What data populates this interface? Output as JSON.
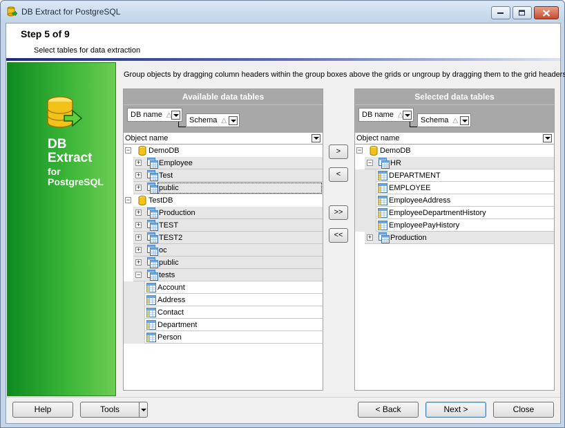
{
  "window": {
    "title": "DB Extract for PostgreSQL"
  },
  "header": {
    "step": "Step 5 of 9",
    "subtitle": "Select tables for data extraction"
  },
  "banner": {
    "line1": "DB",
    "line2": "Extract",
    "line3": "for",
    "line4": "PostgreSQL"
  },
  "hint": "Group objects by dragging column headers within the group boxes above the grids or ungroup by dragging them to the grid headers",
  "left_panel": {
    "title": "Available data tables",
    "group_headers": [
      "DB name",
      "Schema"
    ],
    "column": "Object name",
    "rows": [
      {
        "label": "DemoDB",
        "type": "db",
        "expanded": true
      },
      {
        "label": "Employee",
        "type": "schema"
      },
      {
        "label": "Test",
        "type": "schema"
      },
      {
        "label": "public",
        "type": "schema",
        "selected": true
      },
      {
        "label": "TestDB",
        "type": "db",
        "expanded": true
      },
      {
        "label": "Production",
        "type": "schema"
      },
      {
        "label": "TEST",
        "type": "schema"
      },
      {
        "label": "TEST2",
        "type": "schema"
      },
      {
        "label": "oc",
        "type": "schema"
      },
      {
        "label": "public",
        "type": "schema"
      },
      {
        "label": "tests",
        "type": "schema",
        "expanded": true
      },
      {
        "label": "Account",
        "type": "table"
      },
      {
        "label": "Address",
        "type": "table"
      },
      {
        "label": "Contact",
        "type": "table"
      },
      {
        "label": "Department",
        "type": "table"
      },
      {
        "label": "Person",
        "type": "table"
      }
    ]
  },
  "right_panel": {
    "title": "Selected data tables",
    "group_headers": [
      "DB name",
      "Schema"
    ],
    "column": "Object name",
    "rows": [
      {
        "label": "DemoDB",
        "type": "db",
        "expanded": true
      },
      {
        "label": "HR",
        "type": "schema",
        "expanded": true
      },
      {
        "label": "DEPARTMENT",
        "type": "table"
      },
      {
        "label": "EMPLOYEE",
        "type": "table"
      },
      {
        "label": "EmployeeAddress",
        "type": "table"
      },
      {
        "label": "EmployeeDepartmentHistory",
        "type": "table"
      },
      {
        "label": "EmployeePayHistory",
        "type": "table"
      },
      {
        "label": "Production",
        "type": "schema"
      }
    ]
  },
  "transfer": {
    "add": ">",
    "remove": "<",
    "add_all": ">>",
    "remove_all": "<<"
  },
  "footer": {
    "help": "Help",
    "tools": "Tools",
    "back": "< Back",
    "next": "Next >",
    "close": "Close"
  }
}
